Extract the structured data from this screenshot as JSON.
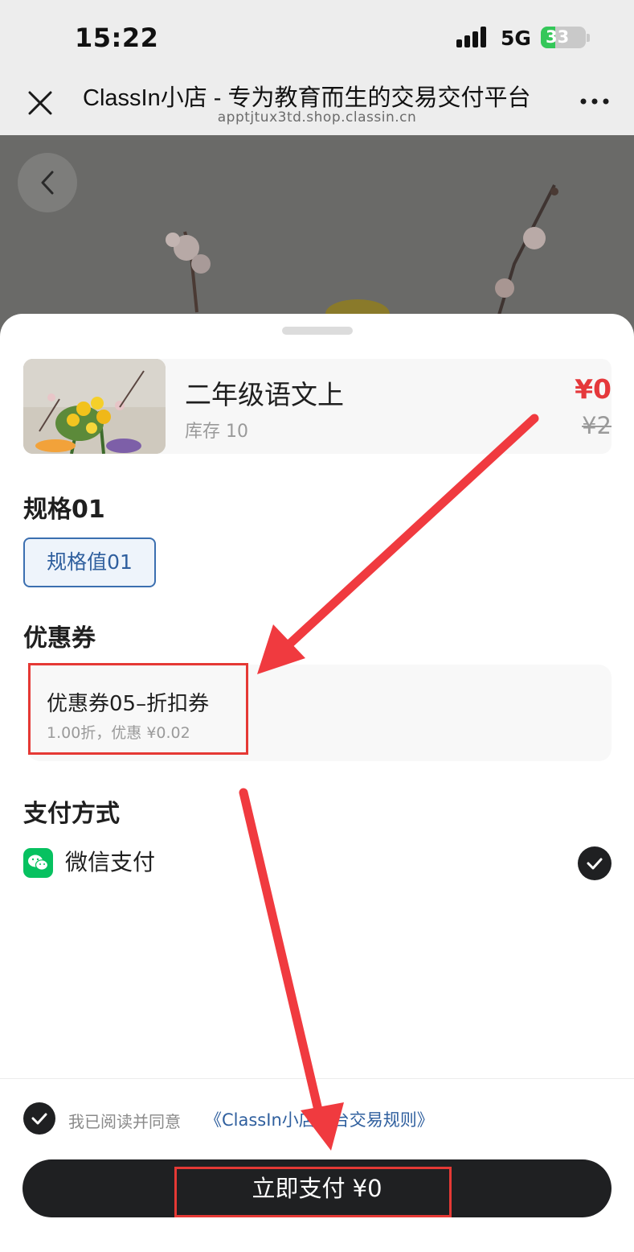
{
  "status_bar": {
    "time": "15:22",
    "network": "5G",
    "battery": "33",
    "battery_level": 0.33
  },
  "nav": {
    "title": "ClassIn小店 - 专为教育而生的交易交付平台",
    "url": "apptjtux3td.shop.classin.cn",
    "close_icon": "close-icon",
    "more_icon": "more-icon"
  },
  "product": {
    "name": "二年级语文上",
    "stock": "库存 10",
    "price_now": "¥0",
    "price_original": "¥2"
  },
  "spec": {
    "title": "规格01",
    "option": "规格值01"
  },
  "coupon": {
    "title": "优惠券",
    "name": "优惠券05–折扣券",
    "desc": "1.00折，优惠 ¥0.02"
  },
  "payment": {
    "title": "支付方式",
    "method": "微信支付",
    "method_icon": "wechat-icon"
  },
  "agreement": {
    "text": "我已阅读并同意",
    "link": "《ClassIn小店平台交易规则》"
  },
  "pay_button": {
    "label": "立即支付 ¥0"
  },
  "colors": {
    "accent_red": "#e53935",
    "price_red": "#e5383b",
    "dark": "#1f2022",
    "wechat_green": "#07c160",
    "link_blue": "#2f5f9e"
  }
}
